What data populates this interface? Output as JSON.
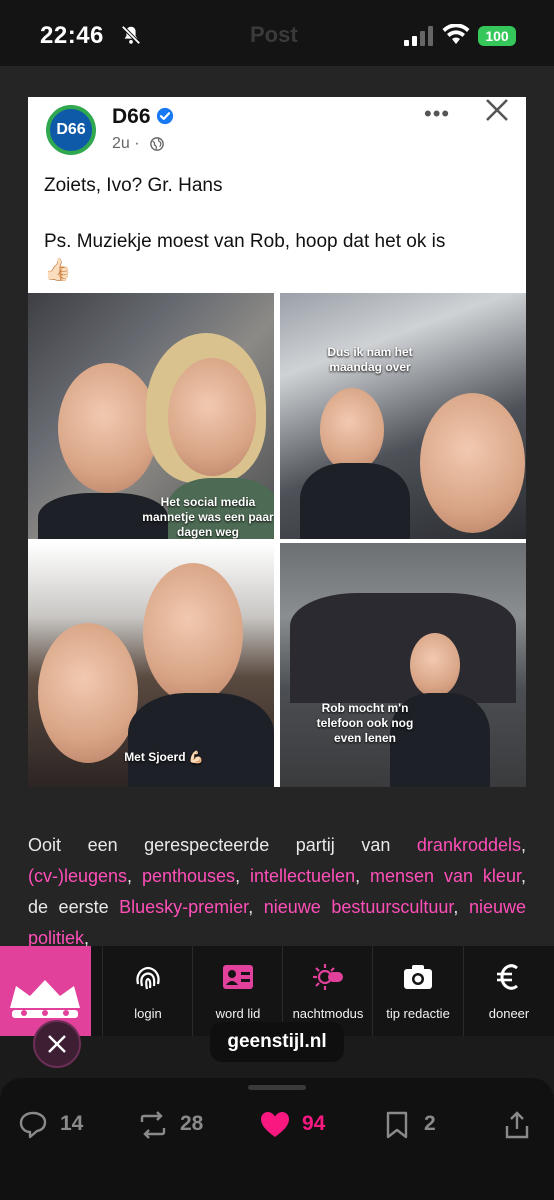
{
  "status_bar": {
    "time": "22:46",
    "ghost_title": "Post",
    "battery": "100"
  },
  "post": {
    "avatar_text": "D66",
    "author": "D66",
    "meta": "2u ·",
    "line1": "Zoiets, Ivo? Gr. Hans",
    "line2": "Ps. Muziekje moest van Rob, hoop dat het ok is",
    "emoji": "👍🏻",
    "captions": {
      "photo1": "Het social media mannetje was een paar dagen weg",
      "photo2": "Dus ik nam het maandag over",
      "photo3": "Met Sjoerd 💪🏻",
      "photo4": "Rob mocht m'n telefoon ook nog even lenen"
    }
  },
  "article": {
    "t1": "Ooit een gerespecteerde partij van ",
    "l1": "drankroddels",
    "t2": ", ",
    "l2": "(cv-)leugens",
    "t3": ", ",
    "l3": "penthouses",
    "t4": ", ",
    "l4": "intellectuelen",
    "t5": ", ",
    "l5": "mensen van kleur",
    "t6": ", de eerste ",
    "l6": "Bluesky-premier",
    "t7": ", ",
    "l7": "nieuwe bestuurscultuur",
    "t8": ", ",
    "l8": "nieuwe politiek",
    "t9": ","
  },
  "toolbar": {
    "items": [
      {
        "label": "login",
        "icon": "fingerprint-icon"
      },
      {
        "label": "word lid",
        "icon": "id-card-icon"
      },
      {
        "label": "nachtmodus",
        "icon": "sun-toggle-icon"
      },
      {
        "label": "tip redactie",
        "icon": "camera-icon"
      },
      {
        "label": "doneer",
        "icon": "euro-icon"
      }
    ],
    "site_url": "geenstijl.nl",
    "brand_color": "#e2419b"
  },
  "actions": {
    "replies": "14",
    "reposts": "28",
    "likes": "94",
    "bookmarks": "2",
    "like_color": "#f91880"
  }
}
